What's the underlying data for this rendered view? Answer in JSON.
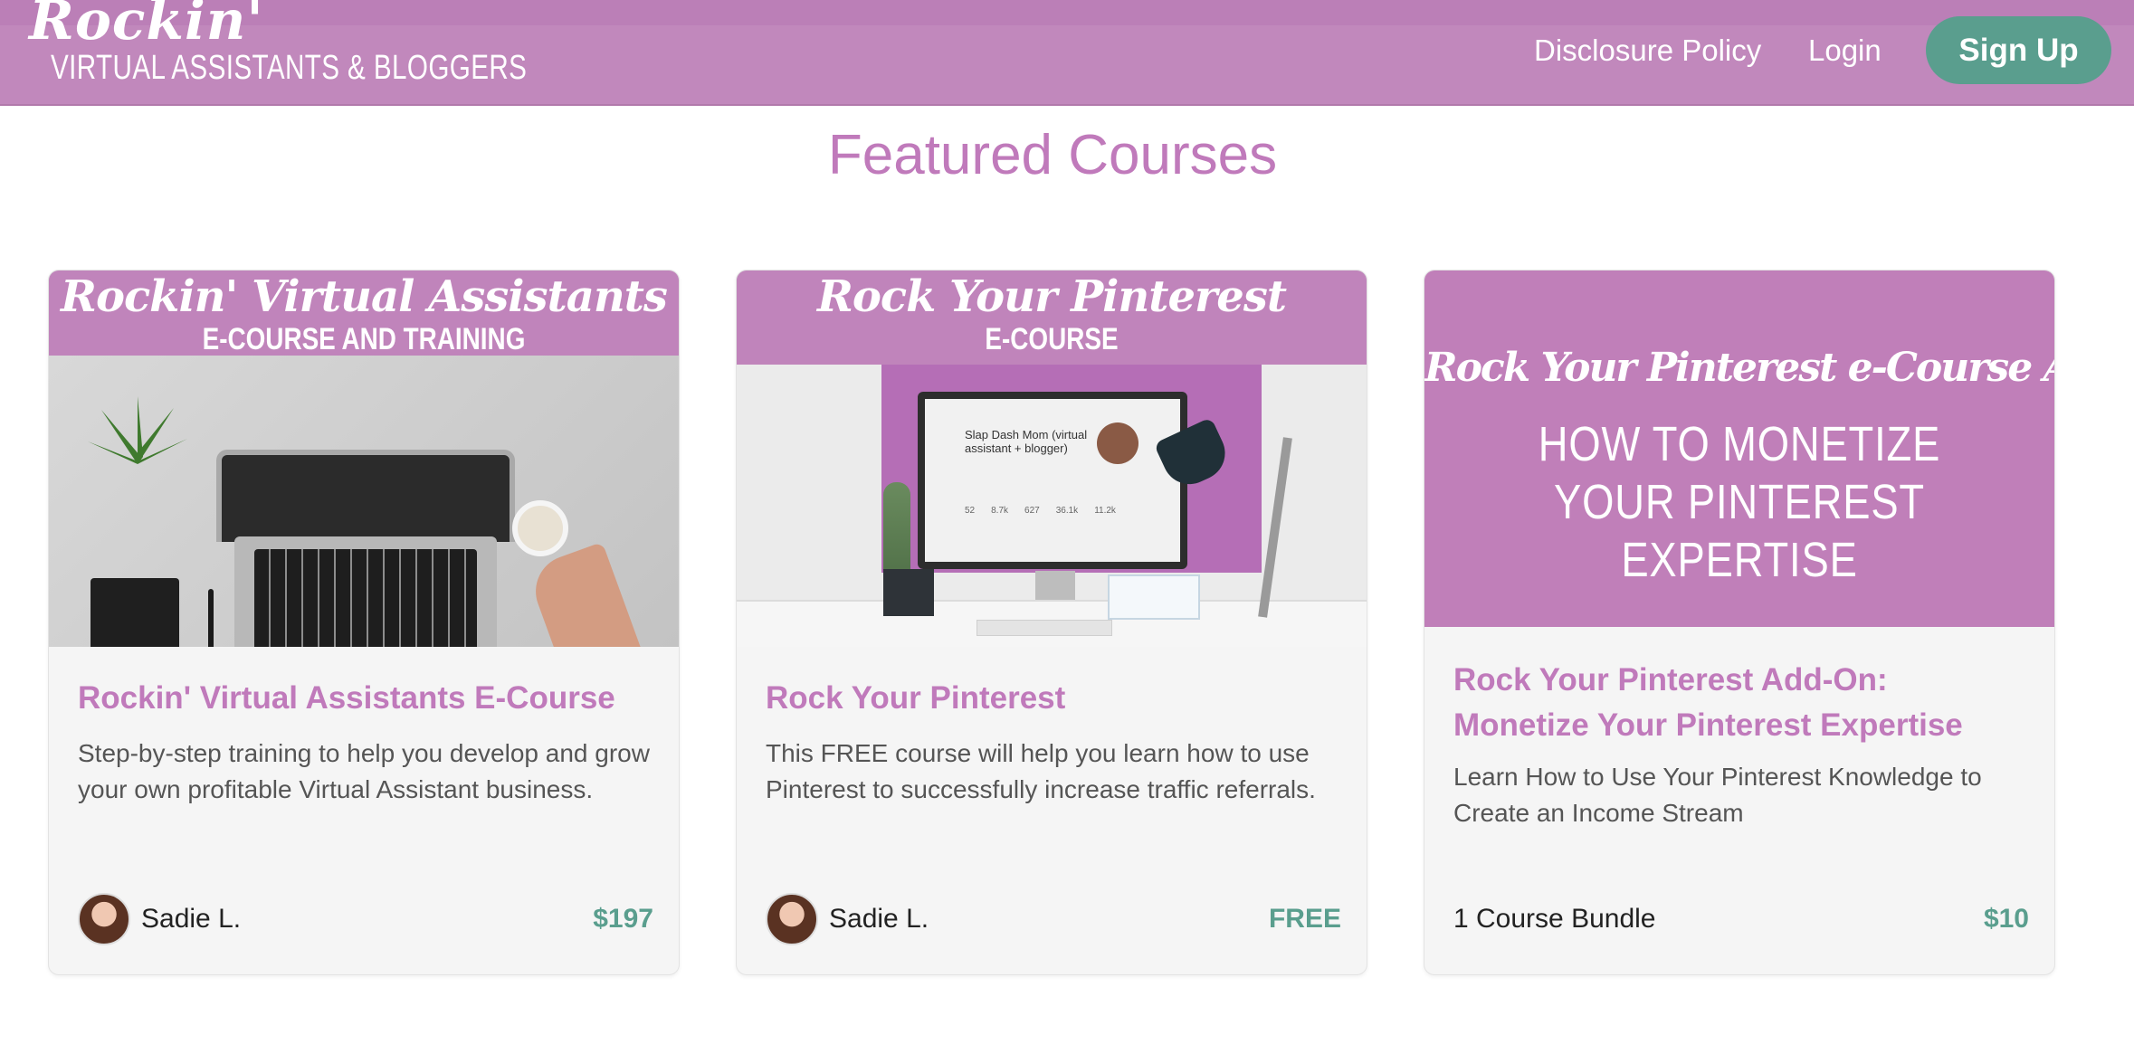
{
  "header": {
    "logo_script": "Rockin'",
    "logo_sub": "VIRTUAL ASSISTANTS & BLOGGERS",
    "nav": {
      "disclosure": "Disclosure Policy",
      "login": "Login",
      "signup": "Sign Up"
    }
  },
  "section_title": "Featured Courses",
  "colors": {
    "brand": "#c188bc",
    "accent_green": "#5a9e8e",
    "title_pink": "#c07abb"
  },
  "cards": [
    {
      "image_banner_script": "Rockin' Virtual Assistants",
      "image_banner_caps": "E-COURSE AND TRAINING",
      "title": "Rockin' Virtual Assistants E-Course",
      "description": "Step-by-step training to help you develop and grow your own profitable Virtual Assistant business.",
      "author": "Sadie L.",
      "price": "$197"
    },
    {
      "image_banner_script": "Rock Your Pinterest",
      "image_banner_caps": "E-COURSE",
      "image_monitor_name": "Slap Dash Mom (virtual assistant + blogger)",
      "image_monitor_stats": [
        "52",
        "8.7k",
        "627",
        "36.1k",
        "11.2k"
      ],
      "title": "Rock Your Pinterest",
      "description": "This FREE course will help you learn how to use Pinterest to successfully increase traffic referrals.",
      "author": "Sadie L.",
      "price": "FREE"
    },
    {
      "image_banner_script": "Rock Your Pinterest e-Course Add-On",
      "image_banner_caps": "HOW TO MONETIZE YOUR PINTEREST EXPERTISE",
      "title": "Rock Your Pinterest Add-On: Monetize Your Pinterest Expertise",
      "description": "Learn How to Use Your Pinterest Knowledge to Create an Income Stream",
      "bundle": "1 Course Bundle",
      "price": "$10"
    }
  ]
}
